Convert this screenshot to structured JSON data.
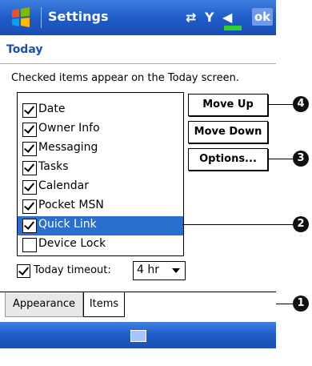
{
  "titlebar": {
    "title": "Settings",
    "ok_label": "ok"
  },
  "page": {
    "heading": "Today",
    "instruction": "Checked items appear on the Today screen."
  },
  "items": [
    {
      "label": "Date",
      "checked": true
    },
    {
      "label": "Owner Info",
      "checked": true
    },
    {
      "label": "Messaging",
      "checked": true
    },
    {
      "label": "Tasks",
      "checked": true
    },
    {
      "label": "Calendar",
      "checked": true
    },
    {
      "label": "Pocket MSN",
      "checked": true
    },
    {
      "label": "Quick Link",
      "checked": true,
      "selected": true
    },
    {
      "label": "Device Lock",
      "checked": false
    }
  ],
  "buttons": {
    "move_up": "Move Up",
    "move_down": "Move Down",
    "options": "Options..."
  },
  "timeout": {
    "label": "Today timeout:",
    "checked": true,
    "value": "4 hr"
  },
  "tabs": [
    {
      "label": "Appearance"
    },
    {
      "label": "Items",
      "active": true
    }
  ],
  "callouts": [
    "1",
    "2",
    "3",
    "4"
  ],
  "colors": {
    "titlebar": "#1f5cc8",
    "selection": "#2a6fcf",
    "heading": "#1a4fb2"
  }
}
